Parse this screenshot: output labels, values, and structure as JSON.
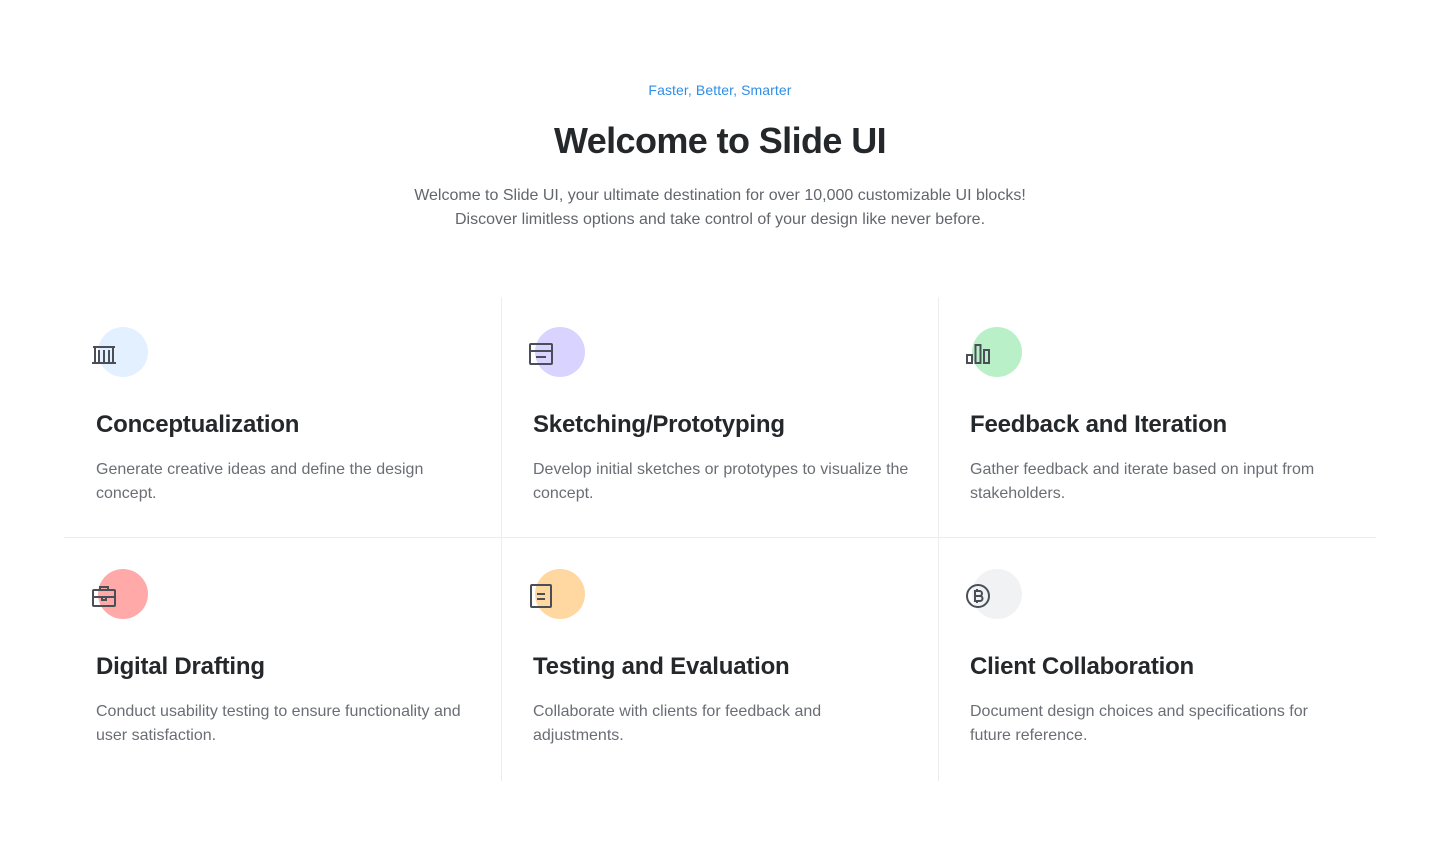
{
  "hero": {
    "eyebrow": "Faster, Better, Smarter",
    "title": "Welcome to Slide UI",
    "subtitle": "Welcome to Slide UI, your ultimate destination for over 10,000 customizable UI blocks! Discover limitless options and take control of your design like never before."
  },
  "features": [
    {
      "title": "Conceptualization",
      "text": "Generate creative ideas and define the design concept.",
      "icon": "bank-icon",
      "color": "#e3f0ff"
    },
    {
      "title": "Sketching/Prototyping",
      "text": "Develop initial sketches or prototypes to visualize the concept.",
      "icon": "browser-window-icon",
      "color": "#d9d3ff"
    },
    {
      "title": "Feedback and Iteration",
      "text": "Gather feedback and iterate based on input from stakeholders.",
      "icon": "bar-chart-icon",
      "color": "#b9f0c8"
    },
    {
      "title": "Digital Drafting",
      "text": "Conduct usability testing to ensure functionality and user satisfaction.",
      "icon": "briefcase-icon",
      "color": "#ffa9a9"
    },
    {
      "title": "Testing and Evaluation",
      "text": "Collaborate with clients for feedback and adjustments.",
      "icon": "document-icon",
      "color": "#ffd7a1"
    },
    {
      "title": "Client Collaboration",
      "text": "Document design choices and specifications for future reference.",
      "icon": "coin-icon",
      "color": "#f1f2f4"
    }
  ]
}
